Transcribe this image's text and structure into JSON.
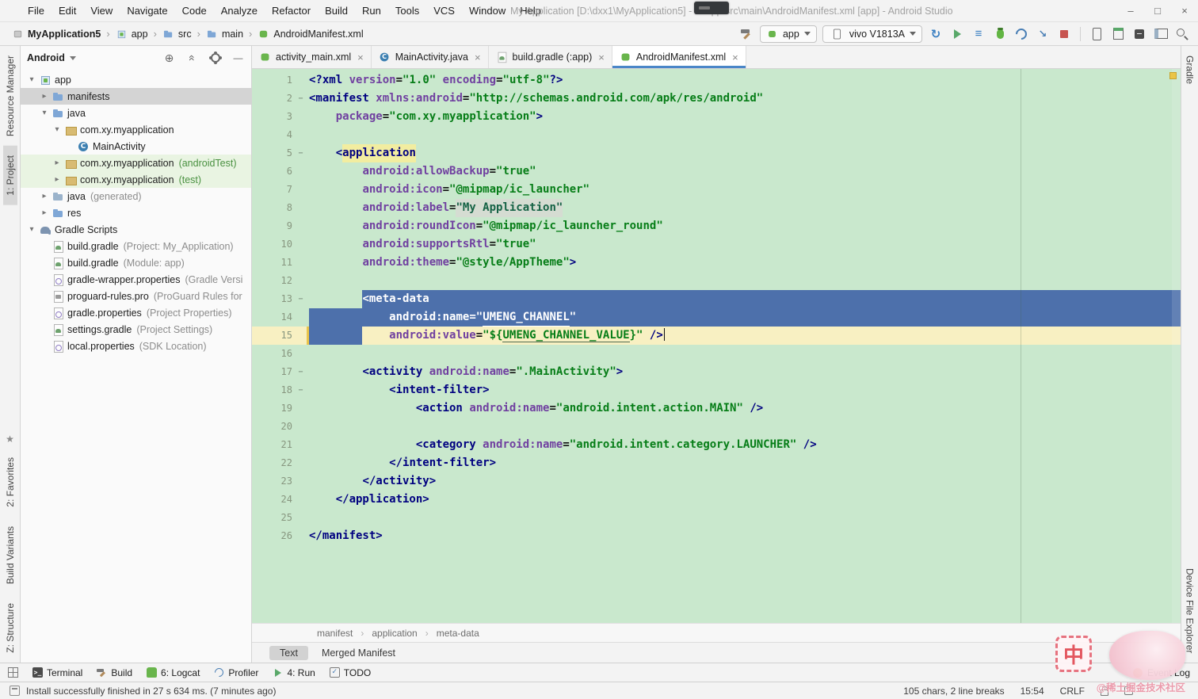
{
  "colors": {
    "editor_background": "#c9e8cd",
    "selection": "#4d70ab",
    "current_line": "#f8f0c2",
    "tag": "#000080",
    "attribute": "#7040a0",
    "string": "#067d17",
    "active_tab_underline": "#4a86c8"
  },
  "title_bar": {
    "menus": [
      "File",
      "Edit",
      "View",
      "Navigate",
      "Code",
      "Analyze",
      "Refactor",
      "Build",
      "Run",
      "Tools",
      "VCS",
      "Window",
      "Help"
    ],
    "title": "My Application [D:\\dxx1\\MyApplication5] - ...\\app\\src\\main\\AndroidManifest.xml [app] - Android Studio",
    "window_controls": [
      "minimize",
      "maximize",
      "close"
    ],
    "window_control_glyphs": {
      "minimize": "–",
      "maximize": "□",
      "close": "×"
    }
  },
  "nav_bar": {
    "crumbs": [
      {
        "icon": "project",
        "label": "MyApplication5"
      },
      {
        "icon": "module",
        "label": "app"
      },
      {
        "icon": "folder",
        "label": "src"
      },
      {
        "icon": "folder",
        "label": "main"
      },
      {
        "icon": "android",
        "label": "AndroidManifest.xml"
      }
    ],
    "toolbar": {
      "run_config": "app",
      "device": "vivo V1813A",
      "icons": [
        "sync",
        "run",
        "run-configurations",
        "debug",
        "profiler",
        "attach-debugger",
        "stop",
        "sep",
        "avd-manager",
        "sdk-manager",
        "logcat",
        "layout-inspector",
        "search"
      ]
    }
  },
  "left_stripe": {
    "top": [
      {
        "label": "Resource Manager",
        "active": false
      },
      {
        "label": "1: Project",
        "active": true
      }
    ],
    "bottom": [
      {
        "label": "2: Favorites",
        "active": false
      },
      {
        "label": "Build Variants",
        "active": false
      },
      {
        "label": "Z: Structure",
        "active": false
      }
    ]
  },
  "right_stripe": {
    "top": [
      {
        "label": "Gradle",
        "active": false
      }
    ],
    "bottom": [
      {
        "label": "Device File Explorer",
        "active": false
      }
    ]
  },
  "project_panel": {
    "view_selector": "Android",
    "header_icons": [
      "locate",
      "collapse",
      "settings",
      "hide"
    ],
    "tree": [
      {
        "icon": "module",
        "label": "app",
        "depth": 0,
        "arrow": "open"
      },
      {
        "icon": "folder",
        "label": "manifests",
        "depth": 1,
        "arrow": "closed",
        "selected": true
      },
      {
        "icon": "folder",
        "label": "java",
        "depth": 1,
        "arrow": "open"
      },
      {
        "icon": "package",
        "label": "com.xy.myapplication",
        "depth": 2,
        "arrow": "open"
      },
      {
        "icon": "class",
        "label": "MainActivity",
        "depth": 3,
        "arrow": "none"
      },
      {
        "icon": "package",
        "label": "com.xy.myapplication",
        "suffix": "(androidTest)",
        "suffix_green": true,
        "depth": 2,
        "arrow": "closed",
        "testbg": true
      },
      {
        "icon": "package",
        "label": "com.xy.myapplication",
        "suffix": "(test)",
        "suffix_green": true,
        "depth": 2,
        "arrow": "closed",
        "testbg": true
      },
      {
        "icon": "folder-gen",
        "label": "java",
        "suffix": "(generated)",
        "depth": 1,
        "arrow": "closed"
      },
      {
        "icon": "folder",
        "label": "res",
        "depth": 1,
        "arrow": "closed"
      },
      {
        "icon": "gradle",
        "label": "Gradle Scripts",
        "depth": 0,
        "arrow": "open"
      },
      {
        "icon": "gradlefile",
        "label": "build.gradle",
        "suffix": "(Project: My_Application)",
        "depth": 1,
        "arrow": "none"
      },
      {
        "icon": "gradlefile",
        "label": "build.gradle",
        "suffix": "(Module: app)",
        "depth": 1,
        "arrow": "none"
      },
      {
        "icon": "props",
        "label": "gradle-wrapper.properties",
        "suffix": "(Gradle Versi",
        "depth": 1,
        "arrow": "none"
      },
      {
        "icon": "proguard",
        "label": "proguard-rules.pro",
        "suffix": "(ProGuard Rules for",
        "depth": 1,
        "arrow": "none"
      },
      {
        "icon": "props",
        "label": "gradle.properties",
        "suffix": "(Project Properties)",
        "depth": 1,
        "arrow": "none"
      },
      {
        "icon": "gradlefile",
        "label": "settings.gradle",
        "suffix": "(Project Settings)",
        "depth": 1,
        "arrow": "none"
      },
      {
        "icon": "props",
        "label": "local.properties",
        "suffix": "(SDK Location)",
        "depth": 1,
        "arrow": "none"
      }
    ]
  },
  "editor_tabs": [
    {
      "icon": "android",
      "label": "activity_main.xml",
      "active": false
    },
    {
      "icon": "class",
      "label": "MainActivity.java",
      "active": false
    },
    {
      "icon": "gradlefile",
      "label": "build.gradle (:app)",
      "active": false
    },
    {
      "icon": "android",
      "label": "AndroidManifest.xml",
      "active": true
    }
  ],
  "editor": {
    "lines": [
      {
        "t": [
          [
            "tag",
            "<?xml"
          ],
          [
            "pl",
            " "
          ],
          [
            "attr",
            "version"
          ],
          [
            "pl",
            "="
          ],
          [
            "val",
            "\"1.0\""
          ],
          [
            "pl",
            " "
          ],
          [
            "attr",
            "encoding"
          ],
          [
            "pl",
            "="
          ],
          [
            "val",
            "\"utf-8\""
          ],
          [
            "tag",
            "?>"
          ]
        ]
      },
      {
        "fold": true,
        "t": [
          [
            "tag",
            "<manifest"
          ],
          [
            "pl",
            " "
          ],
          [
            "attr",
            "xmlns:android"
          ],
          [
            "pl",
            "="
          ],
          [
            "val",
            "\"http://schemas.android.com/apk/res/android\""
          ]
        ]
      },
      {
        "t": [
          [
            "ws",
            "    "
          ],
          [
            "attr",
            "package"
          ],
          [
            "pl",
            "="
          ],
          [
            "val",
            "\"com.xy.myapplication\""
          ],
          [
            "tag",
            ">"
          ]
        ]
      },
      {
        "t": []
      },
      {
        "fold": true,
        "t": [
          [
            "ws",
            "    "
          ],
          [
            "tag",
            "<"
          ],
          [
            "taghl",
            "application"
          ]
        ]
      },
      {
        "t": [
          [
            "ws",
            "        "
          ],
          [
            "attr",
            "android:allowBackup"
          ],
          [
            "pl",
            "="
          ],
          [
            "val",
            "\"true\""
          ]
        ]
      },
      {
        "t": [
          [
            "ws",
            "        "
          ],
          [
            "attr",
            "android:icon"
          ],
          [
            "pl",
            "="
          ],
          [
            "val",
            "\"@mipmap/ic_launcher\""
          ]
        ]
      },
      {
        "t": [
          [
            "ws",
            "        "
          ],
          [
            "attr",
            "android:label"
          ],
          [
            "pl",
            "="
          ],
          [
            "valhl",
            "\"My Application\""
          ]
        ]
      },
      {
        "t": [
          [
            "ws",
            "        "
          ],
          [
            "attr",
            "android:roundIcon"
          ],
          [
            "pl",
            "="
          ],
          [
            "val",
            "\"@mipmap/ic_launcher_round\""
          ]
        ]
      },
      {
        "t": [
          [
            "ws",
            "        "
          ],
          [
            "attr",
            "android:supportsRtl"
          ],
          [
            "pl",
            "="
          ],
          [
            "val",
            "\"true\""
          ]
        ]
      },
      {
        "t": [
          [
            "ws",
            "        "
          ],
          [
            "attr",
            "android:theme"
          ],
          [
            "pl",
            "="
          ],
          [
            "val",
            "\"@style/AppTheme\""
          ],
          [
            "tag",
            ">"
          ]
        ]
      },
      {
        "t": []
      },
      {
        "fold": true,
        "bg": "sel-from",
        "t": [
          [
            "ws",
            "        "
          ],
          [
            "tag",
            "<meta-data"
          ]
        ]
      },
      {
        "bg": "sel",
        "t": [
          [
            "ws",
            "            "
          ],
          [
            "attr",
            "android:name"
          ],
          [
            "pl",
            "="
          ],
          [
            "val",
            "\""
          ],
          [
            "valu",
            "UMENG_CHANNEL"
          ],
          [
            "val",
            "\""
          ]
        ]
      },
      {
        "bg": "cur",
        "t": [
          [
            "ws",
            "        "
          ],
          [
            "ws",
            "    "
          ],
          [
            "attr",
            "android:value"
          ],
          [
            "pl",
            "="
          ],
          [
            "val",
            "\"${"
          ],
          [
            "valu",
            "UMENG_CHANNEL_VALUE"
          ],
          [
            "val",
            "}\""
          ],
          [
            "pl",
            " "
          ],
          [
            "tag",
            "/>"
          ]
        ]
      },
      {
        "t": []
      },
      {
        "fold": true,
        "t": [
          [
            "ws",
            "        "
          ],
          [
            "tag",
            "<activity"
          ],
          [
            "pl",
            " "
          ],
          [
            "attr",
            "android:name"
          ],
          [
            "pl",
            "="
          ],
          [
            "val",
            "\".MainActivity\""
          ],
          [
            "tag",
            ">"
          ]
        ]
      },
      {
        "fold": true,
        "t": [
          [
            "ws",
            "            "
          ],
          [
            "tag",
            "<intent-filter>"
          ]
        ]
      },
      {
        "t": [
          [
            "ws",
            "                "
          ],
          [
            "tag",
            "<action"
          ],
          [
            "pl",
            " "
          ],
          [
            "attr",
            "android:name"
          ],
          [
            "pl",
            "="
          ],
          [
            "val",
            "\"android.intent.action.MAIN\""
          ],
          [
            "pl",
            " "
          ],
          [
            "tag",
            "/>"
          ]
        ]
      },
      {
        "t": []
      },
      {
        "t": [
          [
            "ws",
            "                "
          ],
          [
            "tag",
            "<category"
          ],
          [
            "pl",
            " "
          ],
          [
            "attr",
            "android:name"
          ],
          [
            "pl",
            "="
          ],
          [
            "val",
            "\"android.intent.category.LAUNCHER\""
          ],
          [
            "pl",
            " "
          ],
          [
            "tag",
            "/>"
          ]
        ]
      },
      {
        "t": [
          [
            "ws",
            "            "
          ],
          [
            "tag",
            "</intent-filter>"
          ]
        ]
      },
      {
        "t": [
          [
            "ws",
            "        "
          ],
          [
            "tag",
            "</activity>"
          ]
        ]
      },
      {
        "t": [
          [
            "ws",
            "    "
          ],
          [
            "tag",
            "</application>"
          ]
        ]
      },
      {
        "t": []
      },
      {
        "t": [
          [
            "tag",
            "</manifest>"
          ]
        ]
      }
    ]
  },
  "xml_breadcrumbs": [
    "manifest",
    "application",
    "meta-data"
  ],
  "bottom_tabs": [
    {
      "label": "Text",
      "active": true
    },
    {
      "label": "Merged Manifest",
      "active": false
    }
  ],
  "toolwindow_bar": {
    "items": [
      {
        "label": "Terminal",
        "icon": "terminal"
      },
      {
        "label": "Build",
        "icon": "build"
      },
      {
        "label": "6: Logcat",
        "icon": "logcat"
      },
      {
        "label": "Profiler",
        "icon": "profiler"
      },
      {
        "label": "4: Run",
        "icon": "run"
      },
      {
        "label": "TODO",
        "icon": "todo"
      }
    ],
    "right_label": "Event Log"
  },
  "status_bar": {
    "message": "Install successfully finished in 27 s 634 ms. (7 minutes ago)",
    "selection_info": "105 chars, 2 line breaks",
    "caret_position": "15:54",
    "line_ending": "CRLF"
  },
  "watermark": {
    "stamp_char": "中",
    "text": "@稀土掘金技术社区"
  }
}
